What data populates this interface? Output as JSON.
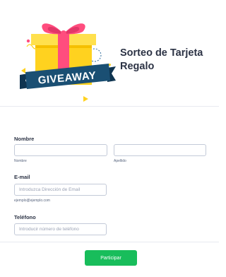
{
  "header": {
    "title": "Sorteo de Tarjeta Regalo",
    "image_text": "GIVEAWAY"
  },
  "fields": {
    "name": {
      "label": "Nombre",
      "first_sublabel": "Nombre",
      "last_sublabel": "Apellido",
      "first_value": "",
      "last_value": ""
    },
    "email": {
      "label": "E-mail",
      "placeholder": "Introduzca Dirección de Email",
      "sublabel": "ejemplo@ejemplo.com"
    },
    "phone": {
      "label": "Teléfono",
      "placeholder": "Introducir número de teléfono"
    }
  },
  "submit_label": "Participar",
  "colors": {
    "accent": "#18bd5b",
    "ribbon": "#ff4d7e",
    "box": "#ffd21f",
    "banner": "#1a4f73"
  }
}
